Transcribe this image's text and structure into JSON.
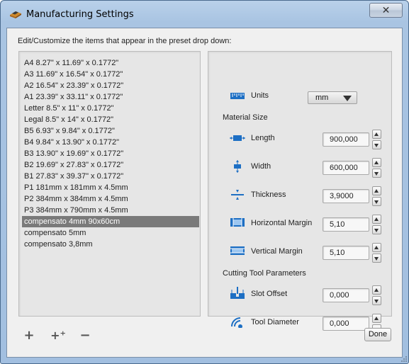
{
  "window": {
    "title": "Manufacturing Settings",
    "close_label": "✕"
  },
  "instruction": "Edit/Customize the items that appear in the preset drop down:",
  "presets": [
    "A4 8.27\" x 11.69\" x 0.1772\"",
    "A3 11.69\" x 16.54\" x 0.1772\"",
    "A2 16.54\" x 23.39\" x 0.1772\"",
    "A1 23.39\" x 33.11\" x 0.1772\"",
    "Letter 8.5\" x 11\" x 0.1772\"",
    "Legal 8.5\" x 14\" x 0.1772\"",
    "B5 6.93\" x 9.84\" x 0.1772\"",
    "B4 9.84\" x 13.90\" x 0.1772\"",
    "B3 13.90\" x 19.69\" x 0.1772\"",
    "B2 19.69\" x 27.83\" x 0.1772\"",
    "B1 27.83\" x 39.37\" x 0.1772\"",
    "P1 181mm x 181mm x 4.5mm",
    "P2 384mm x 384mm x 4.5mm",
    "P3 384mm x 790mm x 4.5mm",
    "compensato 4mm 90x60cm",
    "compensato 5mm",
    "compensato 3,8mm"
  ],
  "selected_preset_index": 14,
  "settings": {
    "units_label": "Units",
    "units_value": "mm",
    "material_size_heading": "Material Size",
    "length_label": "Length",
    "length_value": "900,000",
    "width_label": "Width",
    "width_value": "600,000",
    "thickness_label": "Thickness",
    "thickness_value": "3,9000",
    "hmargin_label": "Horizontal Margin",
    "hmargin_value": "5,10",
    "vmargin_label": "Vertical Margin",
    "vmargin_value": "5,10",
    "cutting_tool_heading": "Cutting Tool Parameters",
    "slot_offset_label": "Slot Offset",
    "slot_offset_value": "0,000",
    "tool_diameter_label": "Tool Diameter",
    "tool_diameter_value": "0,000"
  },
  "buttons": {
    "add": "+",
    "duplicate": "+⁺",
    "remove": "−",
    "done": "Done"
  },
  "colors": {
    "accent_blue": "#1d6fc4",
    "selected_row": "#7a7a7a"
  }
}
